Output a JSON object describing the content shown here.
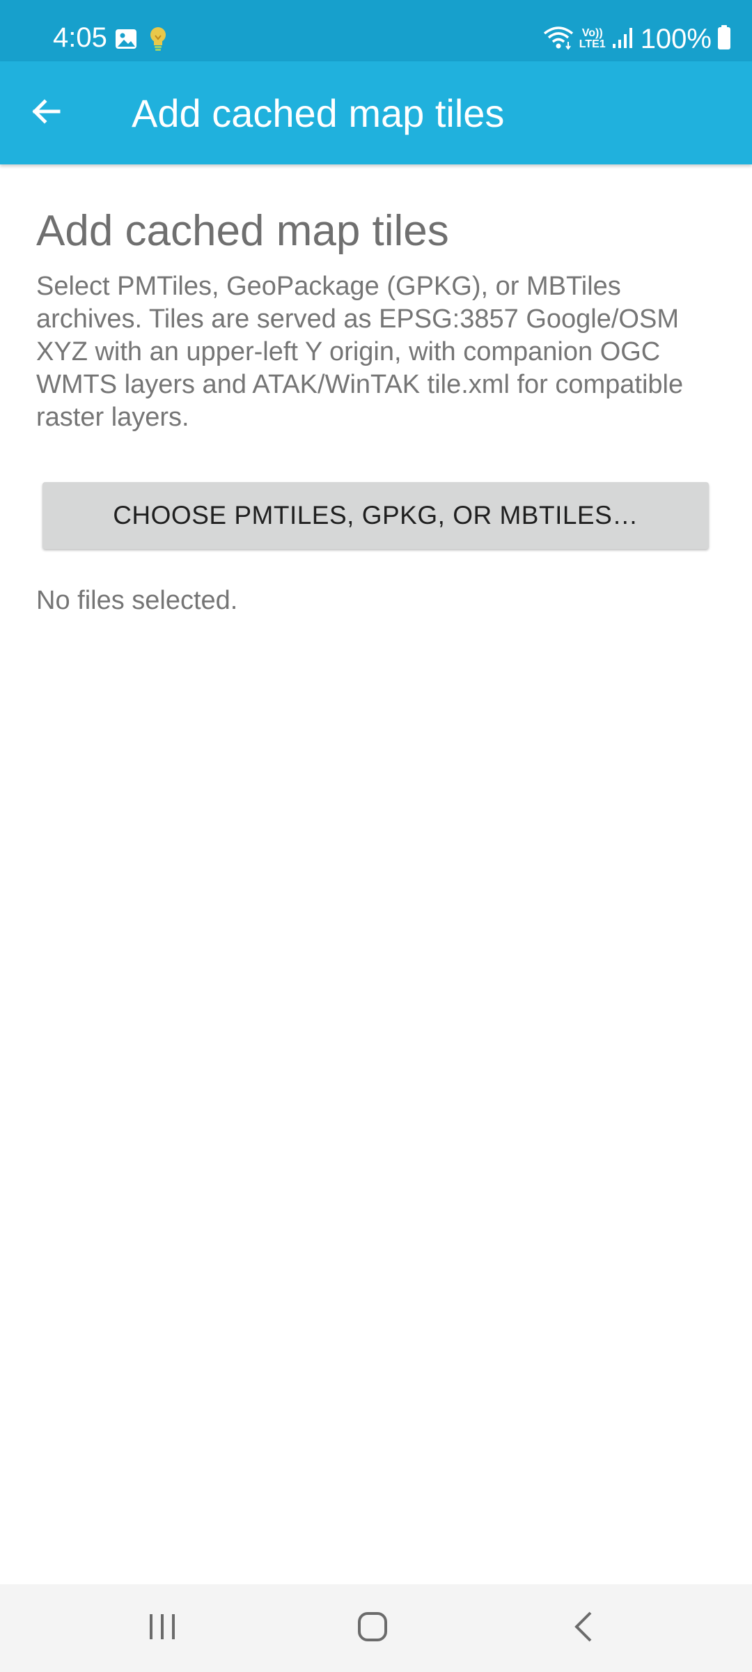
{
  "status_bar": {
    "time": "4:05",
    "battery_text": "100%",
    "icons": [
      "image-icon",
      "lightbulb-icon",
      "wifi-icon",
      "volte-icon",
      "signal-icon",
      "battery-icon"
    ],
    "volte_label_top": "Vo))",
    "volte_label_bottom": "LTE1"
  },
  "app_bar": {
    "title": "Add cached map tiles",
    "back_icon": "arrow-back-icon",
    "color": "#20b1dd"
  },
  "main": {
    "heading": "Add cached map tiles",
    "description": "Select PMTiles, GeoPackage (GPKG), or MBTiles archives. Tiles are served as EPSG:3857 Google/OSM XYZ with an upper-left Y origin, with companion OGC WMTS layers and ATAK/WinTAK tile.xml for compatible raster layers.",
    "choose_button_label": "CHOOSE PMTILES, GPKG, OR MBTILES…",
    "status_text": "No files selected."
  },
  "nav_bar": {
    "buttons": [
      "recents-icon",
      "home-icon",
      "back-icon"
    ]
  },
  "colors": {
    "status_bar": "#17a0cc",
    "app_bar": "#20b1dd",
    "button_bg": "#d6d7d7",
    "text_gray": "#757575"
  }
}
